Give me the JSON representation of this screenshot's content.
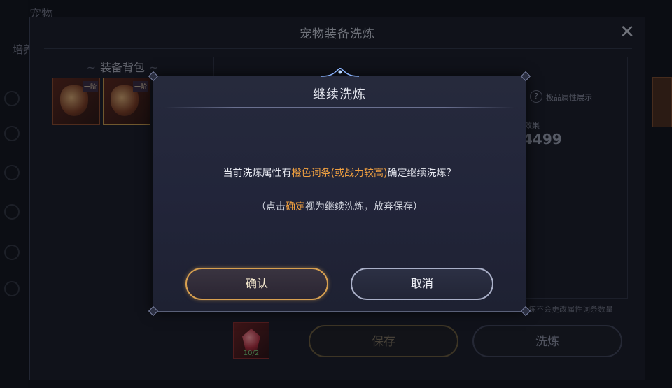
{
  "background": {
    "app_title": "宠物",
    "side_tab": "培养"
  },
  "panel": {
    "title": "宠物装备洗炼",
    "bag_title": "装备背包",
    "slot_tier_label": "一阶",
    "help_label": "极品属性展示",
    "effect_label": "效果",
    "effect_value": "4499",
    "note": "炼不会更改属性词条数量",
    "material_count": "10/2",
    "save_button": "保存",
    "refine_button": "洗炼"
  },
  "dialog": {
    "title": "继续洗炼",
    "line1_prefix": "当前洗炼属性有",
    "line1_highlight": "橙色词条(或战力较高)",
    "line1_suffix": "确定继续洗炼？",
    "line2_prefix": "（点击",
    "line2_highlight": "确定",
    "line2_suffix": "视为继续洗炼，放弃保存）",
    "confirm_button": "确认",
    "cancel_button": "取消"
  },
  "colors": {
    "highlight": "#f0a040",
    "confirm_border": "#d8a050",
    "cancel_border": "#aab0c8",
    "panel_bg": "#191b25"
  },
  "icons": [
    "close-icon",
    "help-icon",
    "equipment-gem-icon",
    "crystal-material-icon"
  ]
}
